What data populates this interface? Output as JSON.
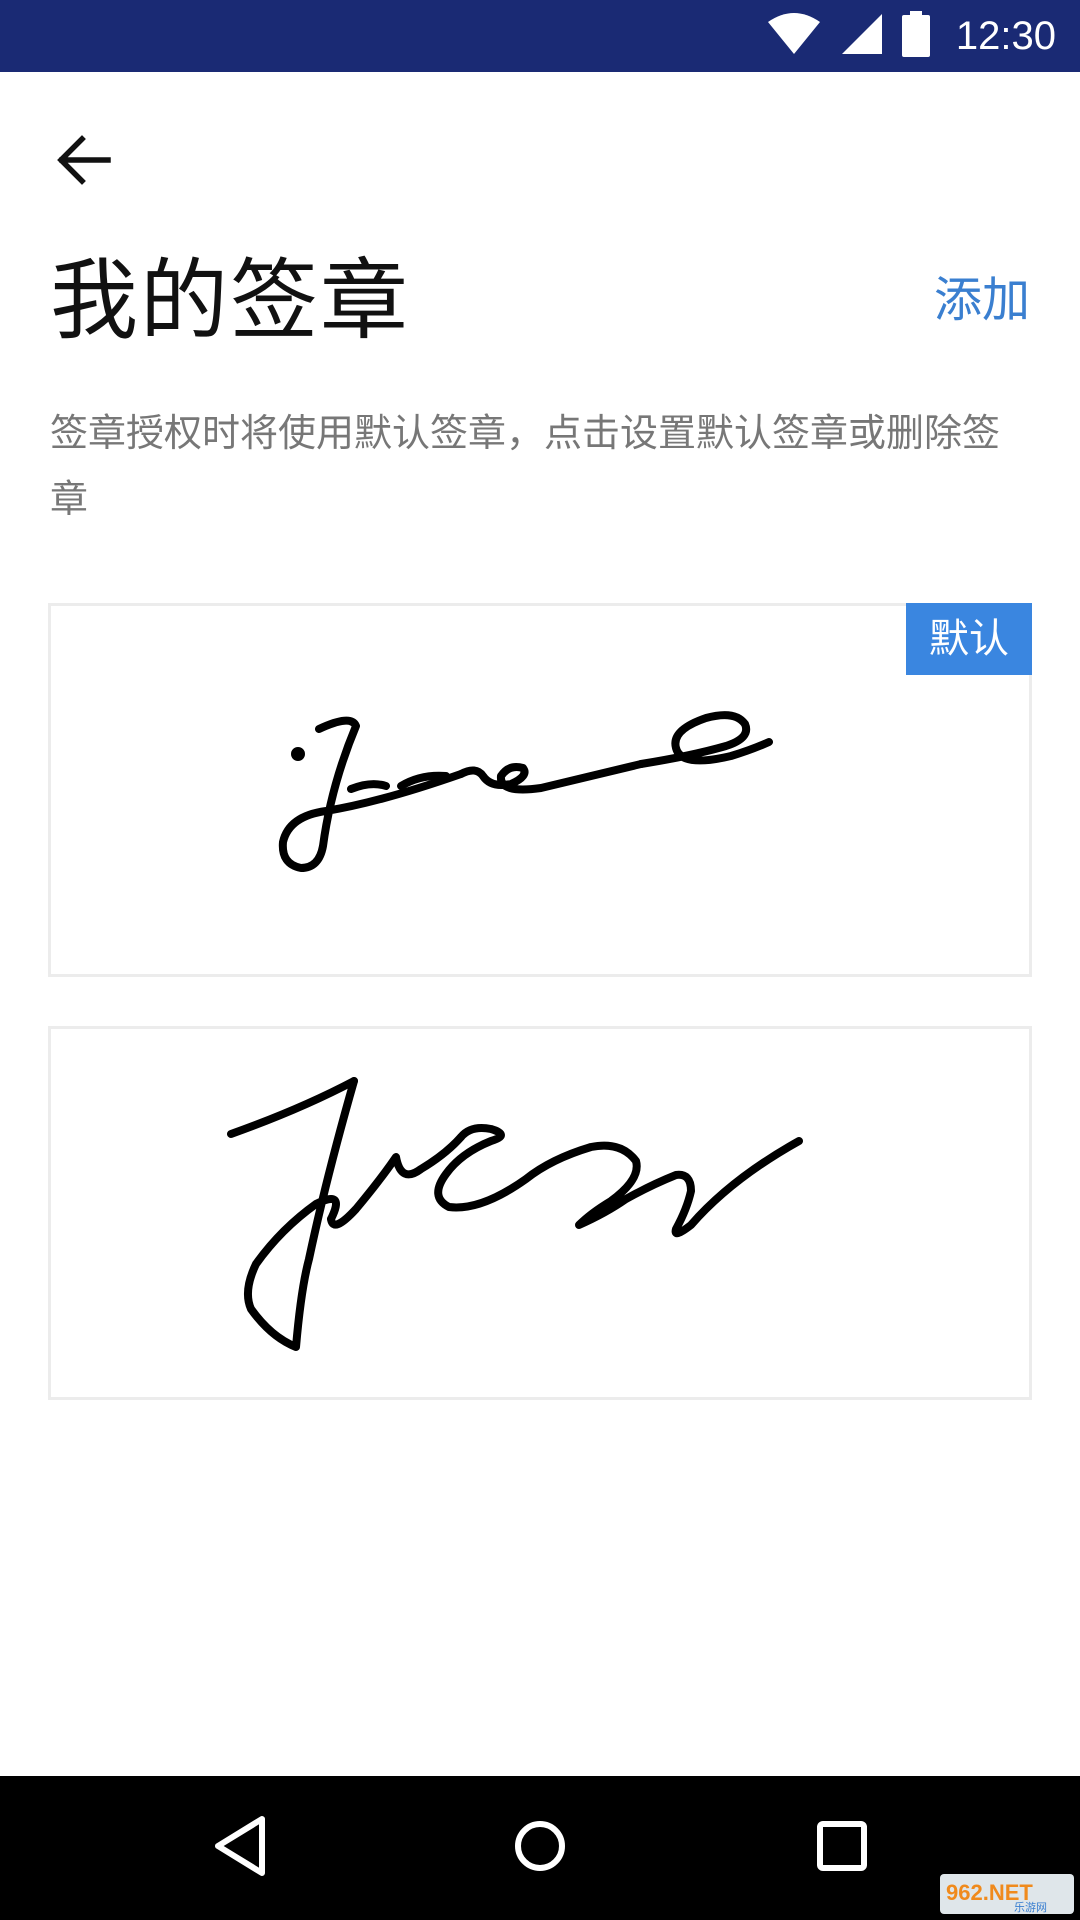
{
  "status_bar": {
    "time": "12:30",
    "icons": [
      "wifi-icon",
      "cell-signal-icon",
      "battery-icon"
    ],
    "background": "#1a2a74"
  },
  "header": {
    "back_icon": "arrow-left-icon",
    "title": "我的签章",
    "add_label": "添加",
    "accent": "#3a7fd0"
  },
  "description": "签章授权时将使用默认签章，点击设置默认签章或删除签章",
  "signatures": [
    {
      "is_default": true,
      "badge_label": "默认"
    },
    {
      "is_default": false
    }
  ],
  "badge_color": "#3a86e0",
  "nav_bar": {
    "icons": [
      "nav-back-icon",
      "nav-home-icon",
      "nav-recent-icon"
    ]
  },
  "watermark": {
    "text": "962.NET",
    "subtext": "乐游网"
  }
}
